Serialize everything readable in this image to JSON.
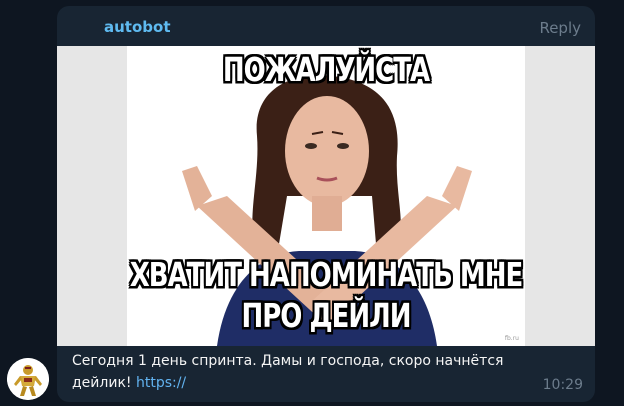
{
  "message": {
    "sender": "autobot",
    "reply_label": "Reply",
    "text": "Сегодня 1 день спринта. Дамы и господа, скоро начнётся дейлик!",
    "link": "https://",
    "time": "10:29"
  },
  "meme": {
    "top_caption": "ПОЖАЛУЙСТА",
    "bottom_caption_line1": "ХВАТИТ НАПОМИНАТЬ МНЕ",
    "bottom_caption_line2": "ПРО ДЕЙЛИ",
    "watermark": "fb.ru"
  },
  "colors": {
    "background": "#0e1621",
    "bubble": "#182533",
    "sender": "#5fbbf1",
    "link": "#62b3f0",
    "muted": "#6c7c8c"
  },
  "avatar": {
    "icon": "robot-avatar-icon"
  }
}
